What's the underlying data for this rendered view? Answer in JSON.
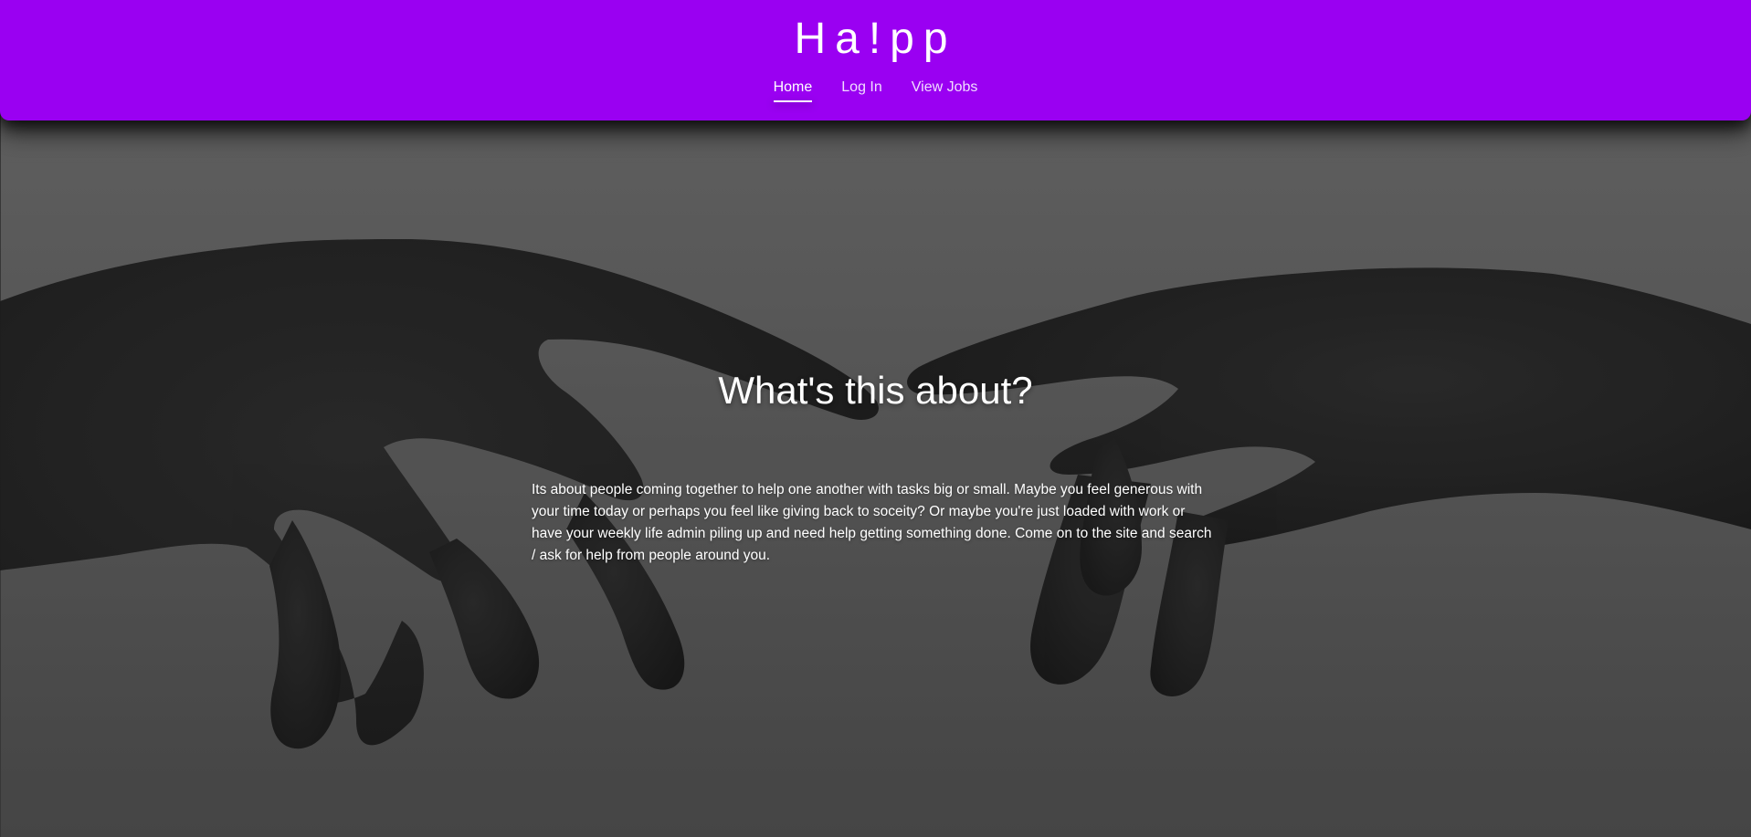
{
  "header": {
    "brand": "Ha!pp",
    "nav": {
      "home": "Home",
      "login": "Log In",
      "jobs": "View Jobs"
    },
    "active_nav": "home"
  },
  "hero": {
    "title": "What's this about?",
    "body": "Its about people coming together to help one another with tasks big or small. Maybe you feel generous with your time today or perhaps you feel like giving back to soceity? Or maybe you're just loaded with work or have your weekly life admin piling up and need help getting something done. Come on to the site and search / ask for help from people around you."
  },
  "colors": {
    "header_background": "#9a00f2",
    "page_background": "#5d5d5d",
    "text": "#ffffff"
  }
}
